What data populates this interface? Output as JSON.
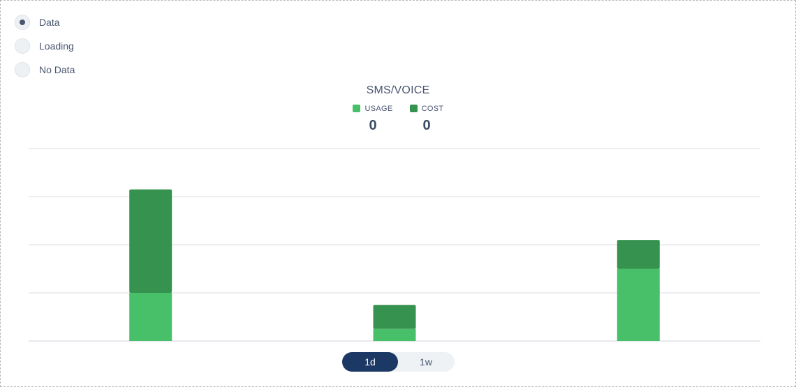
{
  "data_state": {
    "options": [
      {
        "label": "Data",
        "selected": true
      },
      {
        "label": "Loading",
        "selected": false
      },
      {
        "label": "No Data",
        "selected": false
      }
    ]
  },
  "widget": {
    "title": "SMS/VOICE",
    "legend": [
      {
        "label": "USAGE",
        "value": "0",
        "color": "#48c06a"
      },
      {
        "label": "COST",
        "value": "0",
        "color": "#36934f"
      }
    ]
  },
  "chart_data": {
    "type": "bar",
    "stacked": true,
    "categories": [
      "",
      "",
      ""
    ],
    "series": [
      {
        "name": "USAGE",
        "values": [
          1.0,
          0.25,
          1.5
        ],
        "color": "#48c06a"
      },
      {
        "name": "COST",
        "values": [
          2.15,
          0.5,
          0.6
        ],
        "color": "#36934f"
      }
    ],
    "ylim": [
      0,
      4
    ],
    "grid": true,
    "xlabel": "",
    "ylabel": ""
  },
  "period_toggle": {
    "options": [
      {
        "label": "1d",
        "active": true
      },
      {
        "label": "1w",
        "active": false
      }
    ]
  }
}
